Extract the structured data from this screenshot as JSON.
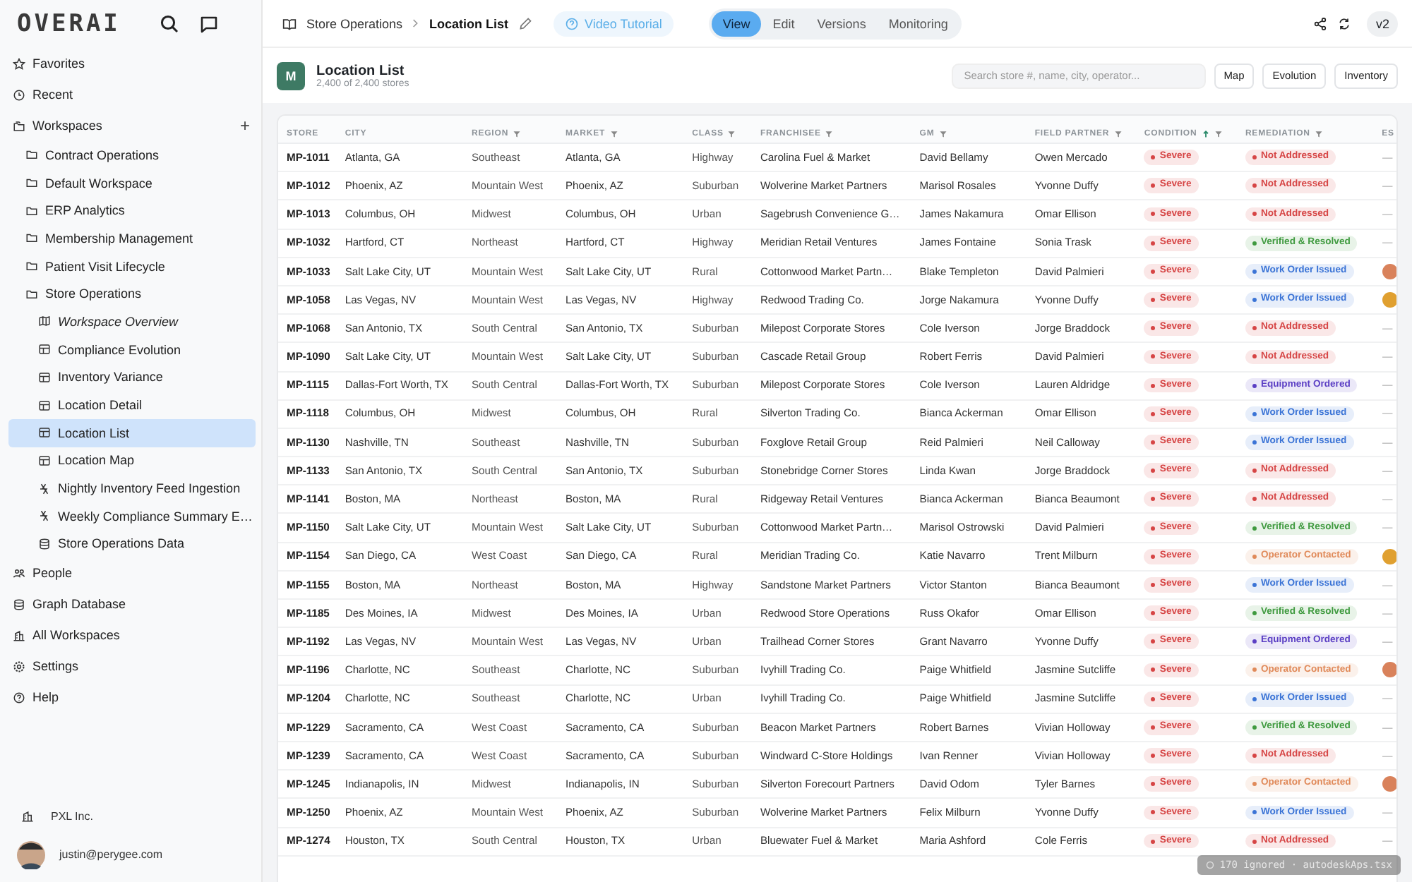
{
  "sidebar": {
    "logo": "OVERAI",
    "top_items": [
      {
        "label": "Favorites",
        "kind": "star",
        "selected": false
      },
      {
        "label": "Recent",
        "kind": "clock",
        "selected": false
      }
    ],
    "workspaces": {
      "label": "Workspaces",
      "add": "+",
      "children": [
        {
          "label": "Contract Operations",
          "kind": "folder",
          "selected": false
        },
        {
          "label": "Default Workspace",
          "kind": "folder",
          "selected": false
        },
        {
          "label": "ERP Analytics",
          "kind": "folder",
          "selected": false
        },
        {
          "label": "Membership Management",
          "kind": "folder",
          "selected": false
        },
        {
          "label": "Patient Visit Lifecycle",
          "kind": "folder",
          "selected": false
        },
        {
          "label": "Store Operations",
          "kind": "folder",
          "selected": false,
          "children": [
            {
              "label": "Workspace Overview",
              "kind": "overview",
              "selected": false
            },
            {
              "label": "Compliance Evolution",
              "kind": "table",
              "selected": false
            },
            {
              "label": "Inventory Variance",
              "kind": "table",
              "selected": false
            },
            {
              "label": "Location Detail",
              "kind": "table",
              "selected": false
            },
            {
              "label": "Location List",
              "kind": "table",
              "selected": true
            },
            {
              "label": "Location Map",
              "kind": "table",
              "selected": false
            },
            {
              "label": "Nightly Inventory Feed Ingestion",
              "kind": "pipeline",
              "selected": false
            },
            {
              "label": "Weekly Compliance Summary E…",
              "kind": "pipeline",
              "selected": false
            },
            {
              "label": "Store Operations Data",
              "kind": "database",
              "selected": false
            }
          ]
        }
      ]
    },
    "bottom_items": [
      {
        "label": "People",
        "kind": "people",
        "selected": false
      },
      {
        "label": "Graph Database",
        "kind": "database",
        "selected": false
      },
      {
        "label": "All Workspaces",
        "kind": "building",
        "selected": false
      },
      {
        "label": "Settings",
        "kind": "gear",
        "selected": false
      },
      {
        "label": "Help",
        "kind": "help",
        "selected": false
      }
    ],
    "org": "PXL Inc.",
    "user": "justin@perygee.com"
  },
  "topbar": {
    "breadcrumb": [
      "Store Operations",
      "Location List"
    ],
    "tutorial": "Video Tutorial",
    "modes": [
      {
        "label": "View",
        "selected": true
      },
      {
        "label": "Edit",
        "selected": false
      },
      {
        "label": "Versions",
        "selected": false
      },
      {
        "label": "Monitoring",
        "selected": false
      }
    ],
    "version": "v2"
  },
  "header": {
    "badge": "M",
    "title": "Location List",
    "subtitle": "2,400 of 2,400 stores",
    "search": {
      "placeholder": "Search store #, name, city, operator..."
    },
    "buttons": [
      "Map",
      "Evolution",
      "Inventory"
    ]
  },
  "table": {
    "columns": [
      {
        "label": "STORE",
        "filter": false,
        "sorted": false
      },
      {
        "label": "CITY",
        "filter": false,
        "sorted": false
      },
      {
        "label": "REGION",
        "filter": true,
        "sorted": false
      },
      {
        "label": "MARKET",
        "filter": true,
        "sorted": false
      },
      {
        "label": "CLASS",
        "filter": true,
        "sorted": false
      },
      {
        "label": "FRANCHISEE",
        "filter": true,
        "sorted": false
      },
      {
        "label": "GM",
        "filter": true,
        "sorted": false
      },
      {
        "label": "FIELD PARTNER",
        "filter": true,
        "sorted": false
      },
      {
        "label": "CONDITION",
        "filter": true,
        "sorted": true
      },
      {
        "label": "REMEDIATION",
        "filter": true,
        "sorted": false
      },
      {
        "label": "ES",
        "filter": false,
        "sorted": false
      }
    ],
    "rows": [
      {
        "cells": [
          "MP-1011",
          "Atlanta, GA",
          "Southeast",
          "Atlanta, GA",
          "Highway",
          "Carolina Fuel & Market",
          "David Bellamy",
          "Owen Mercado"
        ],
        "condition": {
          "label": "Severe",
          "color": "#d64545"
        },
        "remediation": {
          "label": "Not Addressed",
          "color": "#d64545"
        },
        "es": {
          "kind": "dash",
          "text": "—"
        }
      },
      {
        "cells": [
          "MP-1012",
          "Phoenix, AZ",
          "Mountain West",
          "Phoenix, AZ",
          "Suburban",
          "Wolverine Market Partners",
          "Marisol Rosales",
          "Yvonne Duffy"
        ],
        "condition": {
          "label": "Severe",
          "color": "#d64545"
        },
        "remediation": {
          "label": "Not Addressed",
          "color": "#d64545"
        },
        "es": {
          "kind": "dash",
          "text": "—"
        }
      },
      {
        "cells": [
          "MP-1013",
          "Columbus, OH",
          "Midwest",
          "Columbus, OH",
          "Urban",
          "Sagebrush Convenience G…",
          "James Nakamura",
          "Omar Ellison"
        ],
        "condition": {
          "label": "Severe",
          "color": "#d64545"
        },
        "remediation": {
          "label": "Not Addressed",
          "color": "#d64545"
        },
        "es": {
          "kind": "dash",
          "text": "—"
        }
      },
      {
        "cells": [
          "MP-1032",
          "Hartford, CT",
          "Northeast",
          "Hartford, CT",
          "Highway",
          "Meridian Retail Ventures",
          "James Fontaine",
          "Sonia Trask"
        ],
        "condition": {
          "label": "Severe",
          "color": "#d64545"
        },
        "remediation": {
          "label": "Verified & Resolved",
          "color": "#3f9a3f"
        },
        "es": {
          "kind": "dash",
          "text": "—"
        }
      },
      {
        "cells": [
          "MP-1033",
          "Salt Lake City, UT",
          "Mountain West",
          "Salt Lake City, UT",
          "Rural",
          "Cottonwood Market Partn…",
          "Blake Templeton",
          "David Palmieri"
        ],
        "condition": {
          "label": "Severe",
          "color": "#d64545"
        },
        "remediation": {
          "label": "Work Order Issued",
          "color": "#3b74d6"
        },
        "es": {
          "kind": "avatar",
          "color": "#d9825b"
        }
      },
      {
        "cells": [
          "MP-1058",
          "Las Vegas, NV",
          "Mountain West",
          "Las Vegas, NV",
          "Highway",
          "Redwood Trading Co.",
          "Jorge Nakamura",
          "Yvonne Duffy"
        ],
        "condition": {
          "label": "Severe",
          "color": "#d64545"
        },
        "remediation": {
          "label": "Work Order Issued",
          "color": "#3b74d6"
        },
        "es": {
          "kind": "avatar",
          "color": "#e0a030"
        }
      },
      {
        "cells": [
          "MP-1068",
          "San Antonio, TX",
          "South Central",
          "San Antonio, TX",
          "Suburban",
          "Milepost Corporate Stores",
          "Cole Iverson",
          "Jorge Braddock"
        ],
        "condition": {
          "label": "Severe",
          "color": "#d64545"
        },
        "remediation": {
          "label": "Not Addressed",
          "color": "#d64545"
        },
        "es": {
          "kind": "dash",
          "text": "—"
        }
      },
      {
        "cells": [
          "MP-1090",
          "Salt Lake City, UT",
          "Mountain West",
          "Salt Lake City, UT",
          "Suburban",
          "Cascade Retail Group",
          "Robert Ferris",
          "David Palmieri"
        ],
        "condition": {
          "label": "Severe",
          "color": "#d64545"
        },
        "remediation": {
          "label": "Not Addressed",
          "color": "#d64545"
        },
        "es": {
          "kind": "dash",
          "text": "—"
        }
      },
      {
        "cells": [
          "MP-1115",
          "Dallas-Fort Worth, TX",
          "South Central",
          "Dallas-Fort Worth, TX",
          "Suburban",
          "Milepost Corporate Stores",
          "Cole Iverson",
          "Lauren Aldridge"
        ],
        "condition": {
          "label": "Severe",
          "color": "#d64545"
        },
        "remediation": {
          "label": "Equipment Ordered",
          "color": "#5b3fc4"
        },
        "es": {
          "kind": "dash",
          "text": "—"
        }
      },
      {
        "cells": [
          "MP-1118",
          "Columbus, OH",
          "Midwest",
          "Columbus, OH",
          "Rural",
          "Silverton Trading Co.",
          "Bianca Ackerman",
          "Omar Ellison"
        ],
        "condition": {
          "label": "Severe",
          "color": "#d64545"
        },
        "remediation": {
          "label": "Work Order Issued",
          "color": "#3b74d6"
        },
        "es": {
          "kind": "dash",
          "text": "—"
        }
      },
      {
        "cells": [
          "MP-1130",
          "Nashville, TN",
          "Southeast",
          "Nashville, TN",
          "Suburban",
          "Foxglove Retail Group",
          "Reid Palmieri",
          "Neil Calloway"
        ],
        "condition": {
          "label": "Severe",
          "color": "#d64545"
        },
        "remediation": {
          "label": "Work Order Issued",
          "color": "#3b74d6"
        },
        "es": {
          "kind": "dash",
          "text": "—"
        }
      },
      {
        "cells": [
          "MP-1133",
          "San Antonio, TX",
          "South Central",
          "San Antonio, TX",
          "Suburban",
          "Stonebridge Corner Stores",
          "Linda Kwan",
          "Jorge Braddock"
        ],
        "condition": {
          "label": "Severe",
          "color": "#d64545"
        },
        "remediation": {
          "label": "Not Addressed",
          "color": "#d64545"
        },
        "es": {
          "kind": "dash",
          "text": "—"
        }
      },
      {
        "cells": [
          "MP-1141",
          "Boston, MA",
          "Northeast",
          "Boston, MA",
          "Rural",
          "Ridgeway Retail Ventures",
          "Bianca Ackerman",
          "Bianca Beaumont"
        ],
        "condition": {
          "label": "Severe",
          "color": "#d64545"
        },
        "remediation": {
          "label": "Not Addressed",
          "color": "#d64545"
        },
        "es": {
          "kind": "dash",
          "text": "—"
        }
      },
      {
        "cells": [
          "MP-1150",
          "Salt Lake City, UT",
          "Mountain West",
          "Salt Lake City, UT",
          "Suburban",
          "Cottonwood Market Partn…",
          "Marisol Ostrowski",
          "David Palmieri"
        ],
        "condition": {
          "label": "Severe",
          "color": "#d64545"
        },
        "remediation": {
          "label": "Verified & Resolved",
          "color": "#3f9a3f"
        },
        "es": {
          "kind": "dash",
          "text": "—"
        }
      },
      {
        "cells": [
          "MP-1154",
          "San Diego, CA",
          "West Coast",
          "San Diego, CA",
          "Rural",
          "Meridian Trading Co.",
          "Katie Navarro",
          "Trent Milburn"
        ],
        "condition": {
          "label": "Severe",
          "color": "#d64545"
        },
        "remediation": {
          "label": "Operator Contacted",
          "color": "#e08a5a"
        },
        "es": {
          "kind": "avatar",
          "color": "#e0a030"
        }
      },
      {
        "cells": [
          "MP-1155",
          "Boston, MA",
          "Northeast",
          "Boston, MA",
          "Highway",
          "Sandstone Market Partners",
          "Victor Stanton",
          "Bianca Beaumont"
        ],
        "condition": {
          "label": "Severe",
          "color": "#d64545"
        },
        "remediation": {
          "label": "Work Order Issued",
          "color": "#3b74d6"
        },
        "es": {
          "kind": "dash",
          "text": "—"
        }
      },
      {
        "cells": [
          "MP-1185",
          "Des Moines, IA",
          "Midwest",
          "Des Moines, IA",
          "Urban",
          "Redwood Store Operations",
          "Russ Okafor",
          "Omar Ellison"
        ],
        "condition": {
          "label": "Severe",
          "color": "#d64545"
        },
        "remediation": {
          "label": "Verified & Resolved",
          "color": "#3f9a3f"
        },
        "es": {
          "kind": "dash",
          "text": "—"
        }
      },
      {
        "cells": [
          "MP-1192",
          "Las Vegas, NV",
          "Mountain West",
          "Las Vegas, NV",
          "Urban",
          "Trailhead Corner Stores",
          "Grant Navarro",
          "Yvonne Duffy"
        ],
        "condition": {
          "label": "Severe",
          "color": "#d64545"
        },
        "remediation": {
          "label": "Equipment Ordered",
          "color": "#5b3fc4"
        },
        "es": {
          "kind": "dash",
          "text": "—"
        }
      },
      {
        "cells": [
          "MP-1196",
          "Charlotte, NC",
          "Southeast",
          "Charlotte, NC",
          "Suburban",
          "Ivyhill Trading Co.",
          "Paige Whitfield",
          "Jasmine Sutcliffe"
        ],
        "condition": {
          "label": "Severe",
          "color": "#d64545"
        },
        "remediation": {
          "label": "Operator Contacted",
          "color": "#e08a5a"
        },
        "es": {
          "kind": "avatar",
          "color": "#d9825b"
        }
      },
      {
        "cells": [
          "MP-1204",
          "Charlotte, NC",
          "Southeast",
          "Charlotte, NC",
          "Urban",
          "Ivyhill Trading Co.",
          "Paige Whitfield",
          "Jasmine Sutcliffe"
        ],
        "condition": {
          "label": "Severe",
          "color": "#d64545"
        },
        "remediation": {
          "label": "Work Order Issued",
          "color": "#3b74d6"
        },
        "es": {
          "kind": "dash",
          "text": "—"
        }
      },
      {
        "cells": [
          "MP-1229",
          "Sacramento, CA",
          "West Coast",
          "Sacramento, CA",
          "Suburban",
          "Beacon Market Partners",
          "Robert Barnes",
          "Vivian Holloway"
        ],
        "condition": {
          "label": "Severe",
          "color": "#d64545"
        },
        "remediation": {
          "label": "Verified & Resolved",
          "color": "#3f9a3f"
        },
        "es": {
          "kind": "dash",
          "text": "—"
        }
      },
      {
        "cells": [
          "MP-1239",
          "Sacramento, CA",
          "West Coast",
          "Sacramento, CA",
          "Suburban",
          "Windward C-Store Holdings",
          "Ivan Renner",
          "Vivian Holloway"
        ],
        "condition": {
          "label": "Severe",
          "color": "#d64545"
        },
        "remediation": {
          "label": "Not Addressed",
          "color": "#d64545"
        },
        "es": {
          "kind": "dash",
          "text": "—"
        }
      },
      {
        "cells": [
          "MP-1245",
          "Indianapolis, IN",
          "Midwest",
          "Indianapolis, IN",
          "Suburban",
          "Silverton Forecourt Partners",
          "David Odom",
          "Tyler Barnes"
        ],
        "condition": {
          "label": "Severe",
          "color": "#d64545"
        },
        "remediation": {
          "label": "Operator Contacted",
          "color": "#e08a5a"
        },
        "es": {
          "kind": "avatar",
          "color": "#d9825b"
        }
      },
      {
        "cells": [
          "MP-1250",
          "Phoenix, AZ",
          "Mountain West",
          "Phoenix, AZ",
          "Suburban",
          "Wolverine Market Partners",
          "Felix Milburn",
          "Yvonne Duffy"
        ],
        "condition": {
          "label": "Severe",
          "color": "#d64545"
        },
        "remediation": {
          "label": "Work Order Issued",
          "color": "#3b74d6"
        },
        "es": {
          "kind": "dash",
          "text": "—"
        }
      },
      {
        "cells": [
          "MP-1274",
          "Houston, TX",
          "South Central",
          "Houston, TX",
          "Urban",
          "Bluewater Fuel & Market",
          "Maria Ashford",
          "Cole Ferris"
        ],
        "condition": {
          "label": "Severe",
          "color": "#d64545"
        },
        "remediation": {
          "label": "Not Addressed",
          "color": "#d64545"
        },
        "es": {
          "kind": "dash",
          "text": "—"
        }
      }
    ]
  },
  "toast": {
    "text": "170 ignored · autodeskAps.tsx"
  }
}
